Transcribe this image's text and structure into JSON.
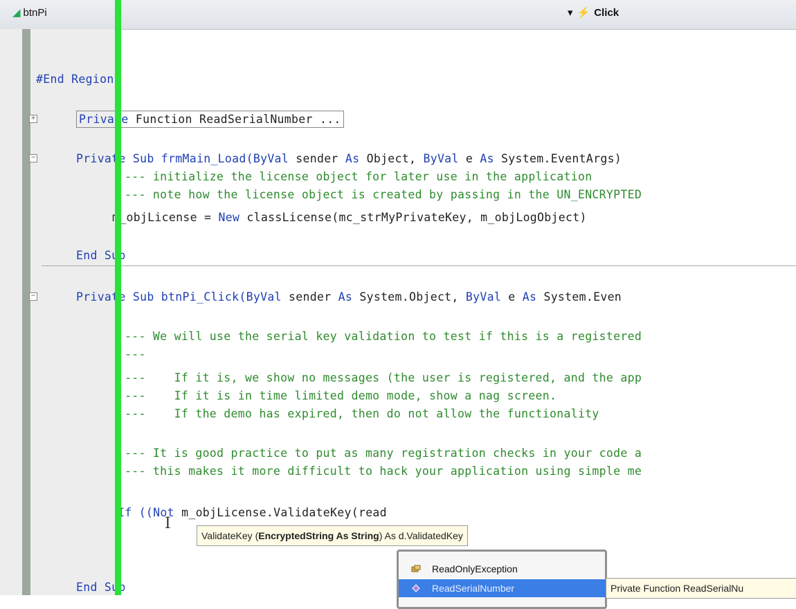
{
  "toolbar": {
    "object_dropdown": "btnPi",
    "event_dropdown": "Click"
  },
  "code": {
    "end_region": "#End Region",
    "fn_read_serial": [
      "Private",
      " Function ReadSerialNumber ..."
    ],
    "load_sub": [
      "Private",
      " Sub frmMain_Load(",
      "ByVal",
      " sender ",
      "As",
      " Object, ",
      "ByVal",
      " e ",
      "As",
      " System.EventArgs)"
    ],
    "comment1": "--- initialize the license object for later use in the application",
    "comment2": "--- note how the license object is created by passing in the UN_ENCRYPTED",
    "license_line": [
      "m_objLicense = ",
      "New",
      " classLicense(mc_strMyPrivateKey, m_objLogObject)"
    ],
    "end_sub_1": [
      "End",
      " Sub"
    ],
    "click_sub": [
      "Private",
      " Sub btnPi_Click(",
      "ByVal",
      " sender ",
      "As",
      " System.Object, ",
      "ByVal",
      " e ",
      "As",
      " System.Even"
    ],
    "comment3": "--- We will use the serial key validation to test if this is a registered",
    "comment4": "---",
    "comment5": "---    If it is, we show no messages (the user is registered, and the app",
    "comment6": "---    If it is in time limited demo mode, show a nag screen.",
    "comment7": "---    If the demo has expired, then do not allow the functionality",
    "comment8": "--- It is good practice to put as many registration checks in your code a",
    "comment9": "--- this makes it more difficult to hack your application using simple me",
    "if_line": [
      "If ((",
      "Not",
      " m_objLicense.ValidateKey(read"
    ],
    "end_sub_2": [
      "End",
      " Sub"
    ]
  },
  "param_tip": {
    "method": "ValidateKey (",
    "param": "EncryptedString As String",
    "rest": ") As d.ValidatedKey"
  },
  "completion": {
    "items": [
      "ReadOnlyException",
      "ReadSerialNumber"
    ],
    "selected_index": 1
  },
  "quick_info": "Private Function ReadSerialNu",
  "colors": {
    "keyword": "#1f3fb4",
    "comment": "#2e8b2e",
    "selection": "#3a7ee6",
    "margin_bar": "#29e23a"
  }
}
